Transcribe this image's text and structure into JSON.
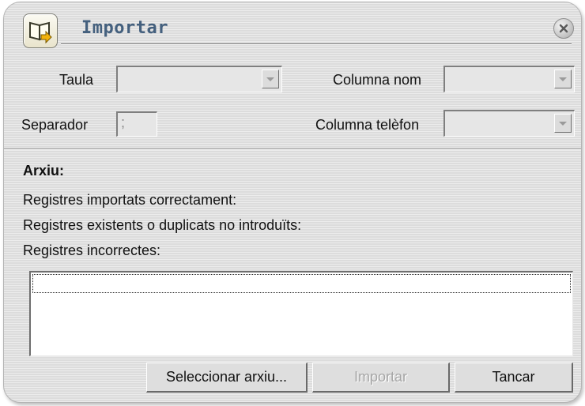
{
  "dialog": {
    "title": "Importar",
    "icons": {
      "app": "import-book-icon",
      "close": "close-icon"
    }
  },
  "form": {
    "taula_label": "Taula",
    "taula_value": "",
    "separador_label": "Separador",
    "separador_value": ";",
    "columna_nom_label": "Columna nom",
    "columna_nom_value": "",
    "columna_telefon_label": "Columna telèfon",
    "columna_telefon_value": ""
  },
  "info": {
    "arxiu_label": "Arxiu:",
    "correct_label": "Registres importats correctament:",
    "duplicates_label": "Registres existents o duplicats no introduïts:",
    "incorrect_label": "Registres incorrectes:"
  },
  "buttons": {
    "select_file": "Seleccionar arxiu...",
    "import": "Importar",
    "close": "Tancar"
  },
  "colors": {
    "title": "#44607e",
    "dialog_bg": "#dcdcdc"
  }
}
